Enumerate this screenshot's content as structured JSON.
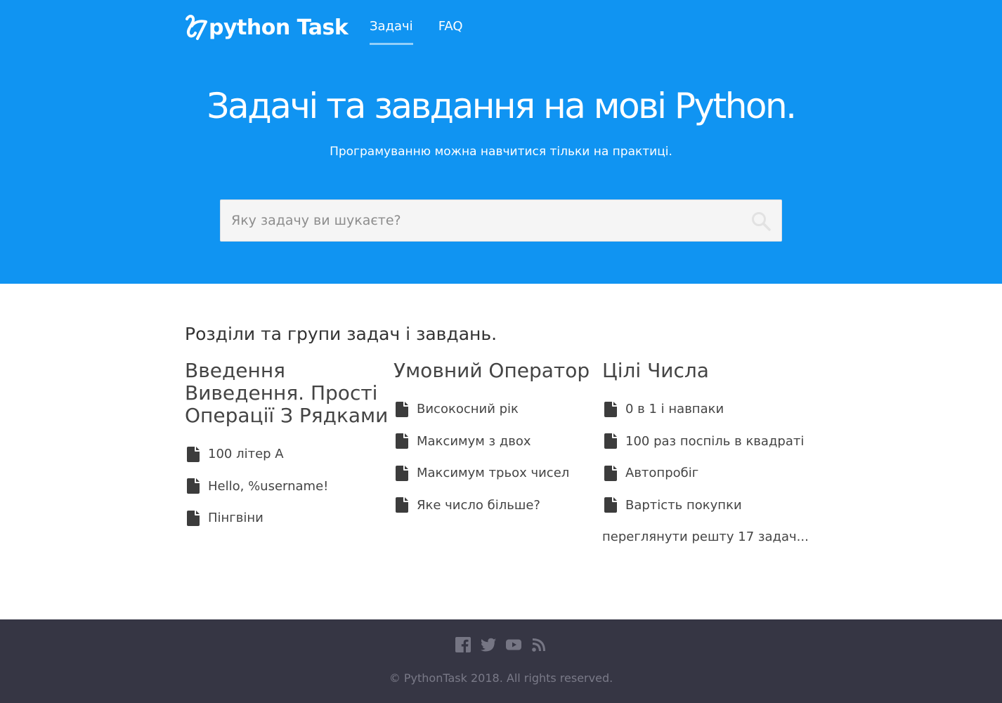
{
  "header": {
    "logo_text": "python Task",
    "nav": [
      {
        "label": "Задачі",
        "active": true
      },
      {
        "label": "FAQ",
        "active": false
      }
    ]
  },
  "hero": {
    "title": "Задачі та завдання на мові Python.",
    "subtitle": "Програмуванню можна навчитися тільки на практиці.",
    "search_placeholder": "Яку задачу ви шукаєте?"
  },
  "main": {
    "title": "Розділи та групи задач і завдань.",
    "groups": [
      {
        "title": "Введення Виведення. Прості Операції З Рядками",
        "tasks": [
          "100 літер A",
          "Hello, %username!",
          "Пінгвіни"
        ]
      },
      {
        "title": "Умовний Оператор",
        "tasks": [
          "Високосний рік",
          "Максимум з двох",
          "Максимум трьох чисел",
          "Яке число більше?"
        ]
      },
      {
        "title": "Цілі Числа",
        "tasks": [
          "0 в 1 і навпаки",
          "100 раз поспіль в квадраті",
          "Автопробіг",
          "Вартість покупки"
        ],
        "more": "переглянути решту 17 задач..."
      }
    ]
  },
  "footer": {
    "social_icons": [
      "facebook-icon",
      "twitter-icon",
      "youtube-icon",
      "rss-icon"
    ],
    "copyright": "© PythonTask 2018. All rights reserved."
  },
  "colors": {
    "hero_bg": "#1094f2",
    "footer_bg": "#363644",
    "search_bg": "#f5f5f5",
    "text": "#444444"
  }
}
